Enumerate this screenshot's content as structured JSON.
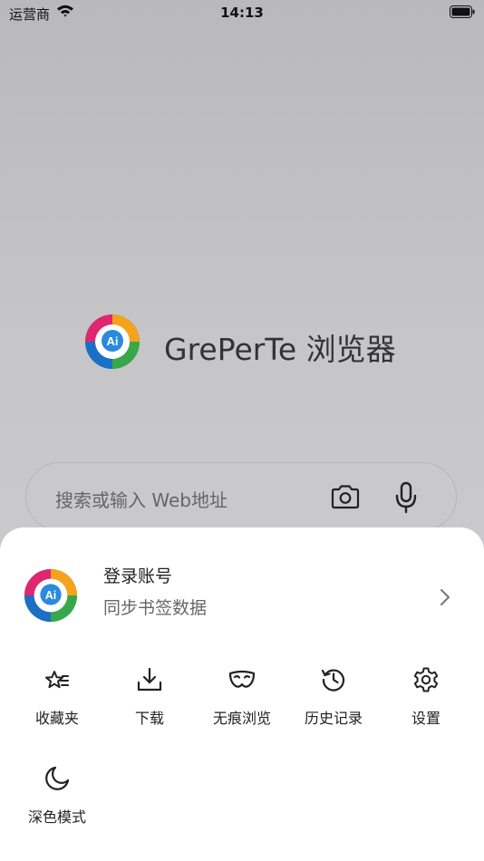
{
  "status_bar": {
    "carrier": "运营商",
    "time": "14:13"
  },
  "home": {
    "brand_name": "GrePerTe 浏览器",
    "logo_text": "Ai",
    "search_placeholder": "搜索或输入 Web地址"
  },
  "sheet": {
    "account": {
      "title": "登录账号",
      "subtitle": "同步书签数据"
    },
    "menu": [
      {
        "label": "收藏夹",
        "icon": "star-list-icon"
      },
      {
        "label": "下载",
        "icon": "download-icon"
      },
      {
        "label": "无痕浏览",
        "icon": "mask-icon"
      },
      {
        "label": "历史记录",
        "icon": "history-icon"
      },
      {
        "label": "设置",
        "icon": "gear-icon"
      },
      {
        "label": "深色模式",
        "icon": "moon-icon"
      }
    ]
  },
  "colors": {
    "sheet_bg": "#ffffff",
    "overlay": "#c6c6c8",
    "text": "#222222",
    "icon": "#222222"
  }
}
